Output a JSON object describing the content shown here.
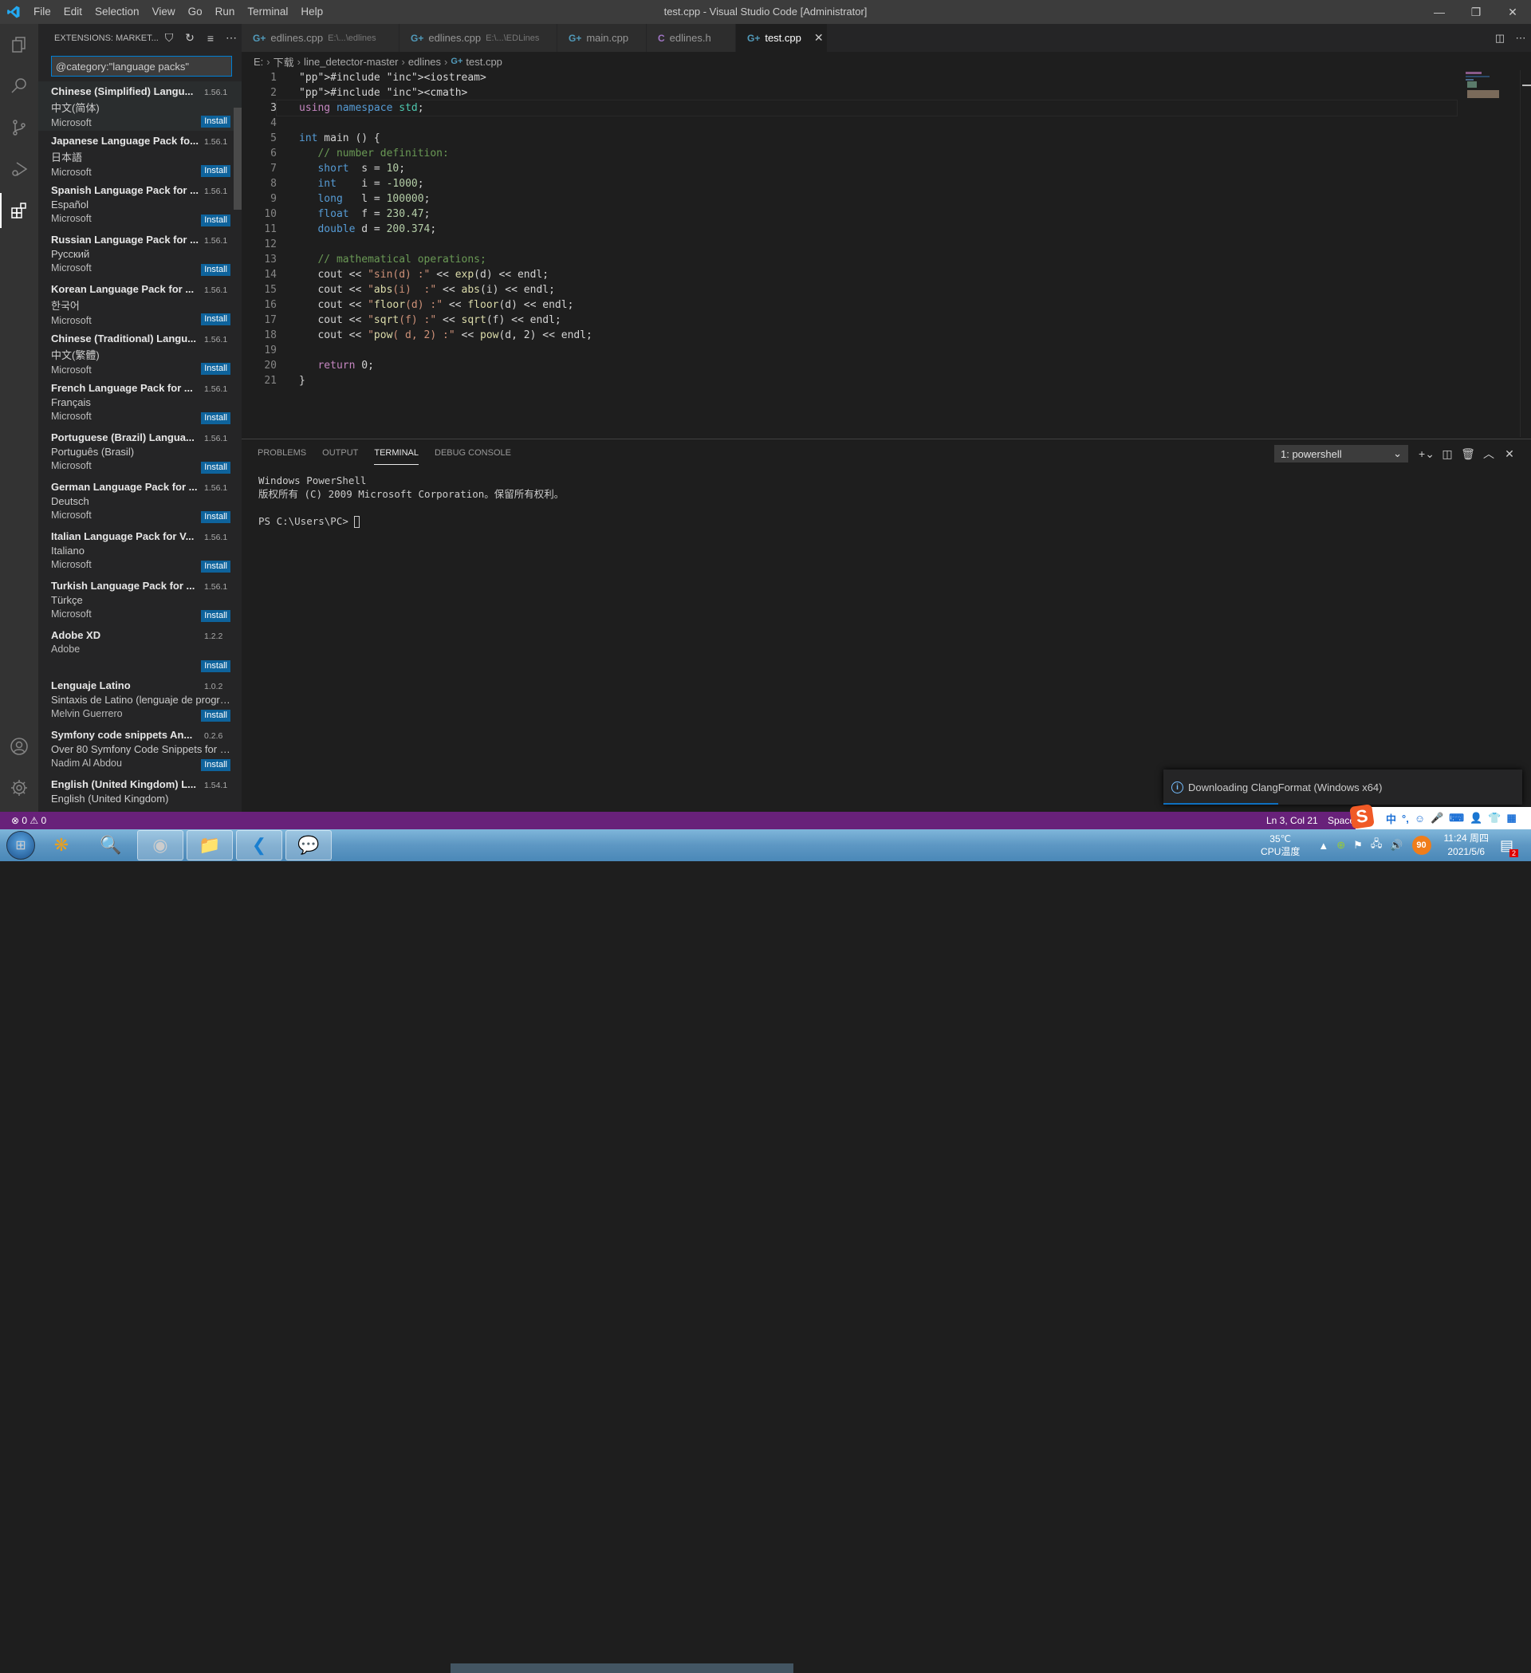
{
  "window": {
    "title": "test.cpp - Visual Studio Code [Administrator]"
  },
  "menu": [
    "File",
    "Edit",
    "Selection",
    "View",
    "Go",
    "Run",
    "Terminal",
    "Help"
  ],
  "sidebar": {
    "title": "EXTENSIONS: MARKET...",
    "search_value": "@category:\"language packs\"",
    "install_label": "Install",
    "extensions": [
      {
        "name": "Chinese (Simplified) Langu...",
        "version": "1.56.1",
        "description": "中文(简体)",
        "publisher": "Microsoft"
      },
      {
        "name": "Japanese Language Pack fo...",
        "version": "1.56.1",
        "description": "日本語",
        "publisher": "Microsoft"
      },
      {
        "name": "Spanish Language Pack for ...",
        "version": "1.56.1",
        "description": "Español",
        "publisher": "Microsoft"
      },
      {
        "name": "Russian Language Pack for ...",
        "version": "1.56.1",
        "description": "Русский",
        "publisher": "Microsoft"
      },
      {
        "name": "Korean Language Pack for ...",
        "version": "1.56.1",
        "description": "한국어",
        "publisher": "Microsoft"
      },
      {
        "name": "Chinese (Traditional) Langu...",
        "version": "1.56.1",
        "description": "中文(繁體)",
        "publisher": "Microsoft"
      },
      {
        "name": "French Language Pack for ...",
        "version": "1.56.1",
        "description": "Français",
        "publisher": "Microsoft"
      },
      {
        "name": "Portuguese (Brazil) Langua...",
        "version": "1.56.1",
        "description": "Português (Brasil)",
        "publisher": "Microsoft"
      },
      {
        "name": "German Language Pack for ...",
        "version": "1.56.1",
        "description": "Deutsch",
        "publisher": "Microsoft"
      },
      {
        "name": "Italian Language Pack for V...",
        "version": "1.56.1",
        "description": "Italiano",
        "publisher": "Microsoft"
      },
      {
        "name": "Turkish Language Pack for ...",
        "version": "1.56.1",
        "description": "Türkçe",
        "publisher": "Microsoft"
      },
      {
        "name": "Adobe XD",
        "version": "1.2.2",
        "description": "",
        "publisher": "Adobe"
      },
      {
        "name": "Lenguaje Latino",
        "version": "1.0.2",
        "description": "Sintaxis de Latino (lenguaje de progra...",
        "publisher": "Melvin Guerrero"
      },
      {
        "name": "Symfony code snippets An...",
        "version": "0.2.6",
        "description": "Over 80 Symfony Code Snippets for P...",
        "publisher": "Nadim Al Abdou"
      },
      {
        "name": "English (United Kingdom) L...",
        "version": "1.54.1",
        "description": "English (United Kingdom)",
        "publisher": ""
      }
    ]
  },
  "tabs": [
    {
      "label": "edlines.cpp",
      "path": "E:\\...\\edlines",
      "icon": "cpp"
    },
    {
      "label": "edlines.cpp",
      "path": "E:\\...\\EDLines",
      "icon": "cpp"
    },
    {
      "label": "main.cpp",
      "path": "",
      "icon": "cpp"
    },
    {
      "label": "edlines.h",
      "path": "",
      "icon": "c"
    },
    {
      "label": "test.cpp",
      "path": "",
      "icon": "cpp",
      "active": true
    }
  ],
  "breadcrumb": [
    "E:",
    "下载",
    "line_detector-master",
    "edlines",
    "test.cpp"
  ],
  "editor": {
    "current_line": 3,
    "lines": [
      "#include <iostream>",
      "#include <cmath>",
      "using namespace std;",
      "",
      "int main () {",
      "   // number definition:",
      "   short  s = 10;",
      "   int    i = -1000;",
      "   long   l = 100000;",
      "   float  f = 230.47;",
      "   double d = 200.374;",
      "",
      "   // mathematical operations;",
      "   cout << \"sin(d) :\" << exp(d) << endl;",
      "   cout << \"abs(i)  :\" << abs(i) << endl;",
      "   cout << \"floor(d) :\" << floor(d) << endl;",
      "   cout << \"sqrt(f) :\" << sqrt(f) << endl;",
      "   cout << \"pow( d, 2) :\" << pow(d, 2) << endl;",
      "",
      "   return 0;",
      "}"
    ]
  },
  "panel": {
    "tabs": [
      "PROBLEMS",
      "OUTPUT",
      "TERMINAL",
      "DEBUG CONSOLE"
    ],
    "active_tab": "TERMINAL",
    "shell_select": "1: powershell",
    "terminal_lines": [
      "Windows PowerShell",
      "版权所有 (C) 2009 Microsoft Corporation。保留所有权利。",
      "",
      "PS C:\\Users\\PC> "
    ]
  },
  "notification": {
    "text": "Downloading ClangFormat (Windows x64)",
    "progress_percent": 32
  },
  "statusbar": {
    "errors": "0",
    "warnings": "0",
    "position": "Ln 3, Col 21",
    "spaces": "Space"
  },
  "ime": {
    "mode": "中",
    "punct": "°,"
  },
  "tray": {
    "temp": "35℃",
    "temp_label": "CPU温度",
    "badge": "90",
    "time": "11:24 周四",
    "date": "2021/5/6",
    "notifications": "2"
  },
  "colors": {
    "statusbar": "#68217a",
    "accent": "#007fd4",
    "install": "#0e639c"
  }
}
